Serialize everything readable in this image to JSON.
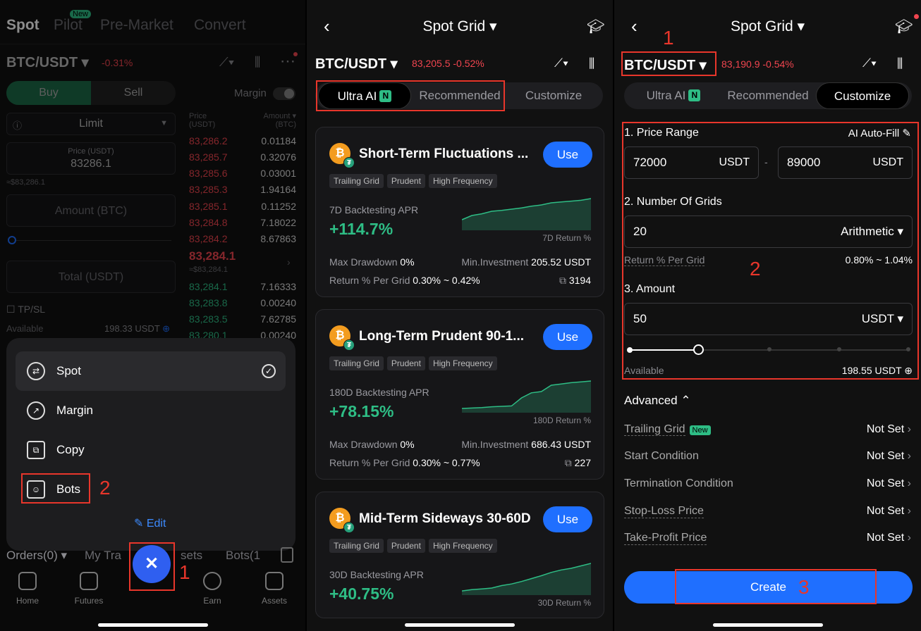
{
  "p1": {
    "tabs": [
      "Spot",
      "Pilot",
      "Pre-Market",
      "Convert"
    ],
    "new_badge": "New",
    "pair": "BTC/USDT",
    "change": "-0.31%",
    "buy": "Buy",
    "sell": "Sell",
    "margin": "Margin",
    "order_type": "Limit",
    "price_label": "Price (USDT)",
    "price_value": "83286.1",
    "price_approx": "≈$83,286.1",
    "amount_placeholder": "Amount (BTC)",
    "total_placeholder": "Total (USDT)",
    "tpsl": "TP/SL",
    "available_label": "Available",
    "available_value": "198.33 USDT",
    "book_header_price": "Price\n(USDT)",
    "book_header_amount": "Amount ▾\n(BTC)",
    "asks": [
      {
        "p": "83,286.2",
        "a": "0.01184"
      },
      {
        "p": "83,285.7",
        "a": "0.32076"
      },
      {
        "p": "83,285.6",
        "a": "0.03001"
      },
      {
        "p": "83,285.3",
        "a": "1.94164"
      },
      {
        "p": "83,285.1",
        "a": "0.11252"
      },
      {
        "p": "83,284.8",
        "a": "7.18022"
      },
      {
        "p": "83,284.2",
        "a": "8.67863"
      }
    ],
    "mid_price": "83,284.1",
    "mid_approx": "≈$83,284.1",
    "bids": [
      {
        "p": "83,284.1",
        "a": "7.16333"
      },
      {
        "p": "83,283.8",
        "a": "0.00240"
      },
      {
        "p": "83,283.5",
        "a": "7.62785"
      },
      {
        "p": "83,280.1",
        "a": "0.00240"
      }
    ],
    "menu": [
      "Spot",
      "Margin",
      "Copy",
      "Bots"
    ],
    "edit": "Edit",
    "orders_bar": [
      "Orders(0) ▾",
      "My Tra",
      "sets",
      "Bots(1"
    ],
    "nav": [
      "Home",
      "Futures",
      "Earn",
      "Assets"
    ],
    "anno1": "1",
    "anno2": "2"
  },
  "p2": {
    "title": "Spot Grid ▾",
    "pair": "BTC/USDT ▾",
    "price": "83,205.5",
    "change": "-0.52%",
    "seg": [
      "Ultra AI",
      "Recommended",
      "Customize"
    ],
    "n_badge": "N",
    "cards": [
      {
        "title": "Short-Term Fluctuations ...",
        "use": "Use",
        "tags": [
          "Trailing Grid",
          "Prudent",
          "High Frequency"
        ],
        "apr_label": "7D Backtesting APR",
        "apr": "+114.7%",
        "ret_label": "7D Return %",
        "dd_label": "Max Drawdown",
        "dd": "0%",
        "inv_label": "Min.Investment",
        "inv": "205.52 USDT",
        "rpg_label": "Return % Per Grid",
        "rpg": "0.30% ~ 0.42%",
        "copies": "3194",
        "spark": [
          20,
          30,
          34,
          40,
          42,
          45,
          48,
          52,
          55,
          60,
          62,
          64,
          66,
          70
        ]
      },
      {
        "title": "Long-Term Prudent 90-1...",
        "use": "Use",
        "tags": [
          "Trailing Grid",
          "Prudent",
          "High Frequency"
        ],
        "apr_label": "180D Backtesting APR",
        "apr": "+78.15%",
        "ret_label": "180D Return %",
        "dd_label": "Max Drawdown",
        "dd": "0%",
        "inv_label": "Min.Investment",
        "inv": "686.43 USDT",
        "rpg_label": "Return % Per Grid",
        "rpg": "0.30% ~ 0.77%",
        "copies": "227",
        "spark": [
          5,
          6,
          7,
          9,
          10,
          11,
          30,
          42,
          45,
          60,
          63,
          66,
          68,
          70
        ]
      },
      {
        "title": "Mid-Term Sideways 30-60D",
        "use": "Use",
        "tags": [
          "Trailing Grid",
          "Prudent",
          "High Frequency"
        ],
        "apr_label": "30D Backtesting APR",
        "apr": "+40.75%",
        "ret_label": "30D Return %",
        "spark": [
          5,
          8,
          10,
          12,
          18,
          22,
          28,
          35,
          42,
          50,
          56,
          60,
          66,
          72
        ]
      }
    ]
  },
  "p3": {
    "title": "Spot Grid ▾",
    "pair": "BTC/USDT ▾",
    "price": "83,190.9",
    "change": "-0.54%",
    "seg": [
      "Ultra AI",
      "Recommended",
      "Customize"
    ],
    "n_badge": "N",
    "s1": "1. Price Range",
    "ai_fill": "AI Auto-Fill",
    "low": "72000",
    "high": "89000",
    "unit": "USDT",
    "dash": "-",
    "s2": "2. Number Of Grids",
    "grids": "20",
    "mode": "Arithmetic ▾",
    "rpg_label": "Return % Per Grid",
    "rpg": "0.80% ~ 1.04%",
    "s3": "3. Amount",
    "amount": "50",
    "amount_unit": "USDT ▾",
    "slider_fraction": 0.25,
    "available_label": "Available",
    "available_value": "198.55 USDT",
    "advanced": "Advanced",
    "adv": [
      {
        "label": "Trailing Grid",
        "value": "Not Set",
        "new": "New"
      },
      {
        "label": "Start Condition",
        "value": "Not Set"
      },
      {
        "label": "Termination Condition",
        "value": "Not Set"
      },
      {
        "label": "Stop-Loss Price",
        "value": "Not Set"
      },
      {
        "label": "Take-Profit Price",
        "value": "Not Set"
      }
    ],
    "create": "Create",
    "anno1": "1",
    "anno2": "2",
    "anno3": "3"
  },
  "colors": {
    "accent": "#1f6fff",
    "up": "#2ebd85",
    "down": "#f0454f",
    "annotation": "#e8362b"
  }
}
